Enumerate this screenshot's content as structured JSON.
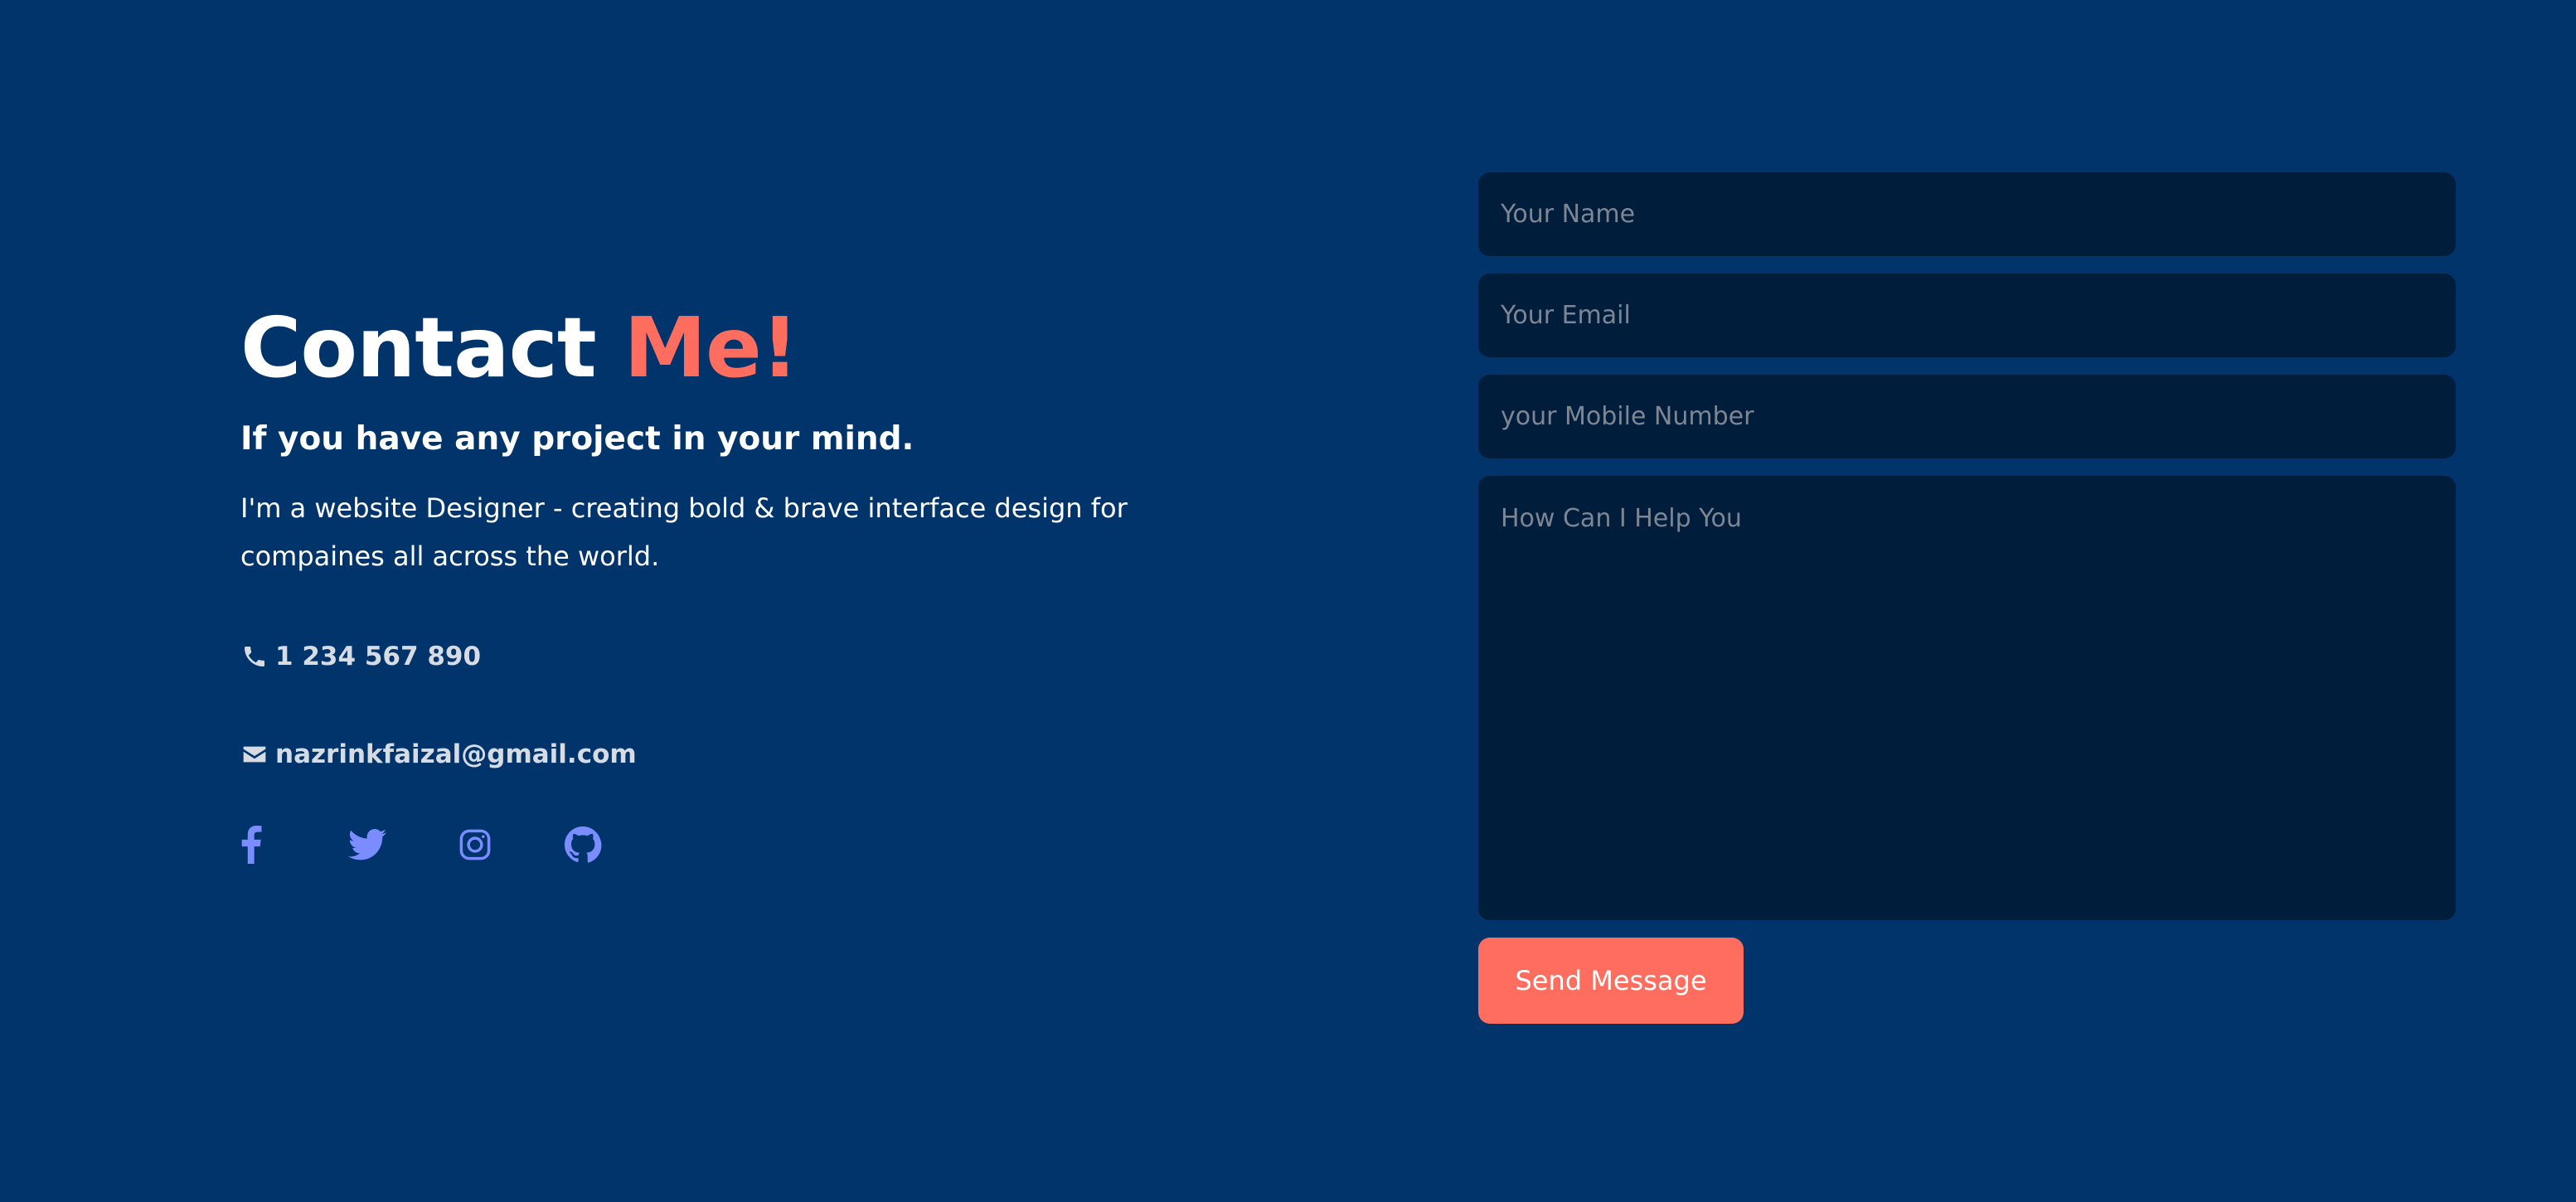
{
  "heading": {
    "main": "Contact",
    "accent": "Me!"
  },
  "subtitle": "If you have any project in your mind.",
  "description": "I'm a website Designer - creating bold & brave interface design for compaines all across the world.",
  "contact": {
    "phone": "1 234 567 890",
    "email": "nazrinkfaizal@gmail.com"
  },
  "socials": [
    {
      "icon": "facebook-icon"
    },
    {
      "icon": "twitter-icon"
    },
    {
      "icon": "instagram-icon"
    },
    {
      "icon": "github-icon"
    }
  ],
  "form": {
    "name_placeholder": "Your Name",
    "email_placeholder": "Your Email",
    "mobile_placeholder": "your Mobile Number",
    "message_placeholder": "How Can I Help You",
    "submit_label": "Send Message"
  },
  "colors": {
    "background": "#00346b",
    "field_background": "#001d3b",
    "accent": "#ff6d5e",
    "social_icon": "#7b8cff",
    "contact_text": "#d6dbe4"
  }
}
